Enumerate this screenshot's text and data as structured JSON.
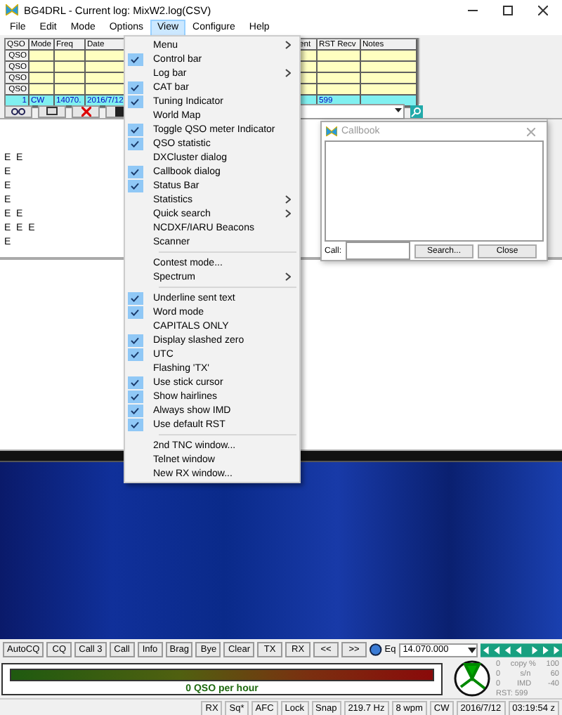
{
  "window": {
    "title": "BG4DRL - Current log: MixW2.log(CSV)"
  },
  "menubar": [
    {
      "label": "File",
      "selected": false
    },
    {
      "label": "Edit",
      "selected": false
    },
    {
      "label": "Mode",
      "selected": false
    },
    {
      "label": "Options",
      "selected": false
    },
    {
      "label": "View",
      "selected": true
    },
    {
      "label": "Configure",
      "selected": false
    },
    {
      "label": "Help",
      "selected": false
    }
  ],
  "log_table": {
    "columns": [
      "QSO",
      "Mode",
      "Freq",
      "Date",
      "ent",
      "RST Recv",
      "Notes"
    ],
    "rows": [
      {
        "selected": false,
        "cells": [
          "QSO",
          "",
          "",
          "",
          "",
          "",
          ""
        ]
      },
      {
        "selected": false,
        "cells": [
          "QSO",
          "",
          "",
          "",
          "",
          "",
          ""
        ]
      },
      {
        "selected": false,
        "cells": [
          "QSO",
          "",
          "",
          "",
          "",
          "",
          ""
        ]
      },
      {
        "selected": false,
        "cells": [
          "QSO",
          "",
          "",
          "",
          "",
          "",
          ""
        ]
      },
      {
        "selected": true,
        "cells": [
          "1",
          "CW",
          "14070.",
          "2016/7/12",
          "",
          "599",
          ""
        ]
      }
    ]
  },
  "view_menu": [
    {
      "kind": "item",
      "label": "Menu",
      "checked": false,
      "submenu": true
    },
    {
      "kind": "item",
      "label": "Control bar",
      "checked": true,
      "submenu": false
    },
    {
      "kind": "item",
      "label": "Log bar",
      "checked": false,
      "submenu": true
    },
    {
      "kind": "item",
      "label": "CAT bar",
      "checked": true,
      "submenu": false
    },
    {
      "kind": "item",
      "label": "Tuning Indicator",
      "checked": true,
      "submenu": false
    },
    {
      "kind": "item",
      "label": "World Map",
      "checked": false,
      "submenu": false
    },
    {
      "kind": "item",
      "label": "Toggle QSO meter Indicator",
      "checked": true,
      "submenu": false
    },
    {
      "kind": "item",
      "label": "QSO statistic",
      "checked": true,
      "submenu": false
    },
    {
      "kind": "item",
      "label": "DXCluster dialog",
      "checked": false,
      "submenu": false
    },
    {
      "kind": "item",
      "label": "Callbook dialog",
      "checked": true,
      "submenu": false
    },
    {
      "kind": "item",
      "label": "Status Bar",
      "checked": true,
      "submenu": false
    },
    {
      "kind": "item",
      "label": "Statistics",
      "checked": false,
      "submenu": true
    },
    {
      "kind": "item",
      "label": "Quick search",
      "checked": false,
      "submenu": true
    },
    {
      "kind": "item",
      "label": "NCDXF/IARU Beacons",
      "checked": false,
      "submenu": false
    },
    {
      "kind": "item",
      "label": "Scanner",
      "checked": false,
      "submenu": false
    },
    {
      "kind": "separator"
    },
    {
      "kind": "item",
      "label": "Contest mode...",
      "checked": false,
      "submenu": false
    },
    {
      "kind": "item",
      "label": "Spectrum",
      "checked": false,
      "submenu": true
    },
    {
      "kind": "separator"
    },
    {
      "kind": "item",
      "label": "Underline sent text",
      "checked": true,
      "submenu": false
    },
    {
      "kind": "item",
      "label": "Word mode",
      "checked": true,
      "submenu": false
    },
    {
      "kind": "item",
      "label": "CAPITALS ONLY",
      "checked": false,
      "submenu": false
    },
    {
      "kind": "item",
      "label": "Display slashed zero",
      "checked": true,
      "submenu": false
    },
    {
      "kind": "item",
      "label": "UTC",
      "checked": true,
      "submenu": false
    },
    {
      "kind": "item",
      "label": "Flashing 'TX'",
      "checked": false,
      "submenu": false
    },
    {
      "kind": "item",
      "label": "Use stick cursor",
      "checked": true,
      "submenu": false
    },
    {
      "kind": "item",
      "label": "Show hairlines",
      "checked": true,
      "submenu": false
    },
    {
      "kind": "item",
      "label": "Always show IMD",
      "checked": true,
      "submenu": false
    },
    {
      "kind": "item",
      "label": "Use default RST",
      "checked": true,
      "submenu": false
    },
    {
      "kind": "separator"
    },
    {
      "kind": "item",
      "label": "2nd TNC window...",
      "checked": false,
      "submenu": false
    },
    {
      "kind": "item",
      "label": "Telnet window",
      "checked": false,
      "submenu": false
    },
    {
      "kind": "item",
      "label": "New RX window...",
      "checked": false,
      "submenu": false
    }
  ],
  "rx_text": [
    "E  E",
    "E",
    "E",
    "E",
    "E  E",
    "E  E  E",
    "E"
  ],
  "callbook": {
    "title": "Callbook",
    "call_label": "Call:",
    "buttons": [
      "Search...",
      "Close"
    ]
  },
  "macro_buttons": [
    "AutoCQ",
    "CQ",
    "Call 3",
    "Call",
    "Info",
    "Brag",
    "Bye",
    "Clear",
    "TX",
    "RX",
    "<<",
    ">>"
  ],
  "frequency": {
    "label": "Eq",
    "value": "14.070.000"
  },
  "qso_meter": {
    "label": "0 QSO per hour"
  },
  "indicators": [
    {
      "min": "0",
      "label": "copy %",
      "max": "100"
    },
    {
      "min": "0",
      "label": "s/n",
      "max": "60"
    },
    {
      "min": "0",
      "label": "IMD",
      "max": "-40"
    }
  ],
  "rst": "RST: 599",
  "status_bar": [
    "RX",
    "Sq*",
    "AFC",
    "Lock",
    "Snap",
    "219.7 Hz",
    "8 wpm",
    "CW",
    "2016/7/12",
    "03:19:54 z"
  ]
}
